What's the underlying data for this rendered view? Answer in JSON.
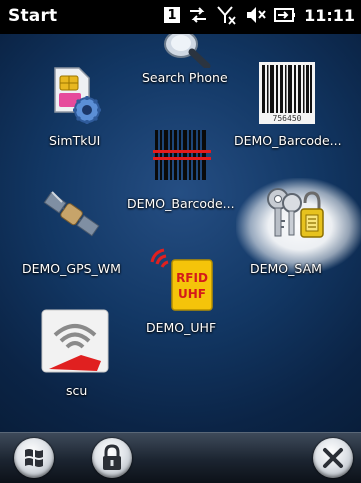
{
  "status_bar": {
    "title": "Start",
    "badge": "1",
    "icons": [
      "data-sync-icon",
      "no-signal-icon",
      "speaker-muted-icon",
      "battery-charging-icon"
    ],
    "time": "11:11"
  },
  "apps": [
    {
      "label": "Search Phone",
      "icon": "search-phone-icon"
    },
    {
      "label": "SimTkUI",
      "icon": "sim-gear-icon"
    },
    {
      "label": "DEMO_Barcode...",
      "icon": "barcode-icon"
    },
    {
      "label": "DEMO_Barcode...",
      "icon": "barcode-laser-icon"
    },
    {
      "label": "DEMO_GPS_WM",
      "icon": "satellite-icon"
    },
    {
      "label": "DEMO_SAM",
      "icon": "keys-lock-icon"
    },
    {
      "label": "DEMO_UHF",
      "icon": "rfid-uhf-icon"
    },
    {
      "label": "scu",
      "icon": "scu-wifi-icon"
    }
  ],
  "rfid_text": [
    "RFID",
    "UHF"
  ],
  "barcode_digits": "756450",
  "taskbar": {
    "buttons": [
      "windows-start-icon",
      "lock-icon",
      "close-icon"
    ]
  },
  "colors": {
    "background": "#123764",
    "status_bar": "#000000",
    "selection_glow": "#ffffff",
    "scu_red": "#e02020",
    "rfid_yellow": "#f5c40a"
  }
}
